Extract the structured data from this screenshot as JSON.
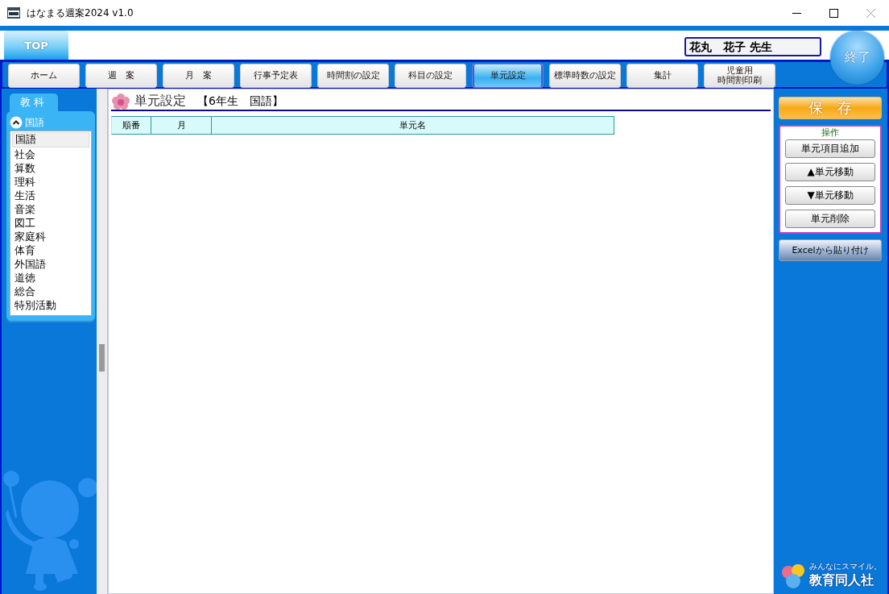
{
  "window": {
    "title": "はなまる週案2024 v1.0"
  },
  "header": {
    "top_tab": {
      "label": "TOP",
      "selected": true
    },
    "teacher_name": "花丸　花子 先生",
    "exit_button": "終了"
  },
  "nav": [
    {
      "label": "ホーム",
      "selected": false
    },
    {
      "label": "週　案",
      "selected": false
    },
    {
      "label": "月　案",
      "selected": false
    },
    {
      "label": "行事予定表",
      "selected": false
    },
    {
      "label": "時間割の設定",
      "selected": false
    },
    {
      "label": "科目の設定",
      "selected": false
    },
    {
      "label": "単元設定",
      "selected": true
    },
    {
      "label": "標準時数の設定",
      "selected": false
    },
    {
      "label": "集計",
      "selected": false
    },
    {
      "label_lines": [
        "児童用",
        "時間割印刷"
      ],
      "selected": false
    }
  ],
  "sidebar": {
    "tab": "教科",
    "dropdown": {
      "value": "国語",
      "expanded": true
    },
    "subjects": [
      {
        "label": "国語",
        "selected": true
      },
      {
        "label": "社会",
        "selected": false
      },
      {
        "label": "算数",
        "selected": false
      },
      {
        "label": "理科",
        "selected": false
      },
      {
        "label": "生活",
        "selected": false
      },
      {
        "label": "音楽",
        "selected": false
      },
      {
        "label": "図工",
        "selected": false
      },
      {
        "label": "家庭科",
        "selected": false
      },
      {
        "label": "体育",
        "selected": false
      },
      {
        "label": "外国語",
        "selected": false
      },
      {
        "label": "道徳",
        "selected": false
      },
      {
        "label": "総合",
        "selected": false
      },
      {
        "label": "特別活動",
        "selected": false
      }
    ]
  },
  "content": {
    "title": "単元設定",
    "subtitle": "【6年生　国語】",
    "table": {
      "columns": [
        "順番",
        "月",
        "単元名"
      ]
    }
  },
  "actions": {
    "save_button": "保　存",
    "operations": {
      "title": "操作",
      "buttons": [
        "単元項目追加",
        "▲単元移動",
        "▼単元移動",
        "単元削除"
      ]
    },
    "paste_button": "Excelから貼り付け"
  },
  "logo": {
    "tagline": "みんなにスマイル。",
    "name": "教育同人社"
  }
}
